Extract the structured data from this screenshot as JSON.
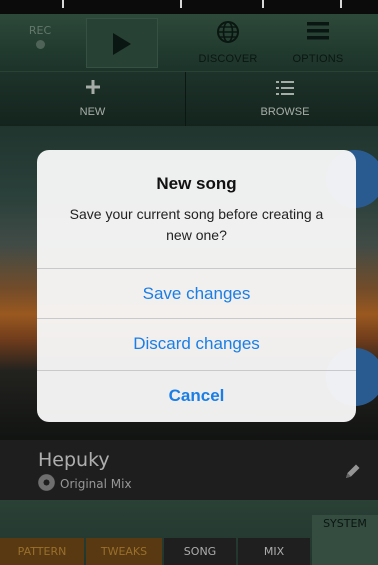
{
  "toolbar": {
    "rec_label": "REC",
    "discover_label": "DISCOVER",
    "options_label": "OPTIONS",
    "icons": {
      "play": "play-icon",
      "discover": "globe-icon",
      "options": "hamburger-menu-icon"
    }
  },
  "navbar": {
    "new_label": "NEW",
    "browse_label": "BROWSE",
    "icons": {
      "new": "plus-icon",
      "browse": "list-icon"
    }
  },
  "song": {
    "title": "Hepuky",
    "subtitle": "Original Mix",
    "icons": {
      "subtitle": "disc-icon",
      "edit": "pencil-icon"
    }
  },
  "tabs": {
    "pattern": "PATTERN",
    "tweaks": "TWEAKS",
    "song": "SONG",
    "mix": "MIX",
    "system": "SYSTEM"
  },
  "dialog": {
    "title": "New song",
    "message": "Save your current song before creating a new one?",
    "save_label": "Save changes",
    "discard_label": "Discard changes",
    "cancel_label": "Cancel"
  },
  "colors": {
    "accent_blue": "#1a7ee6",
    "toolbar_green": "#3f6650",
    "tab_orange": "#d69a3c"
  }
}
